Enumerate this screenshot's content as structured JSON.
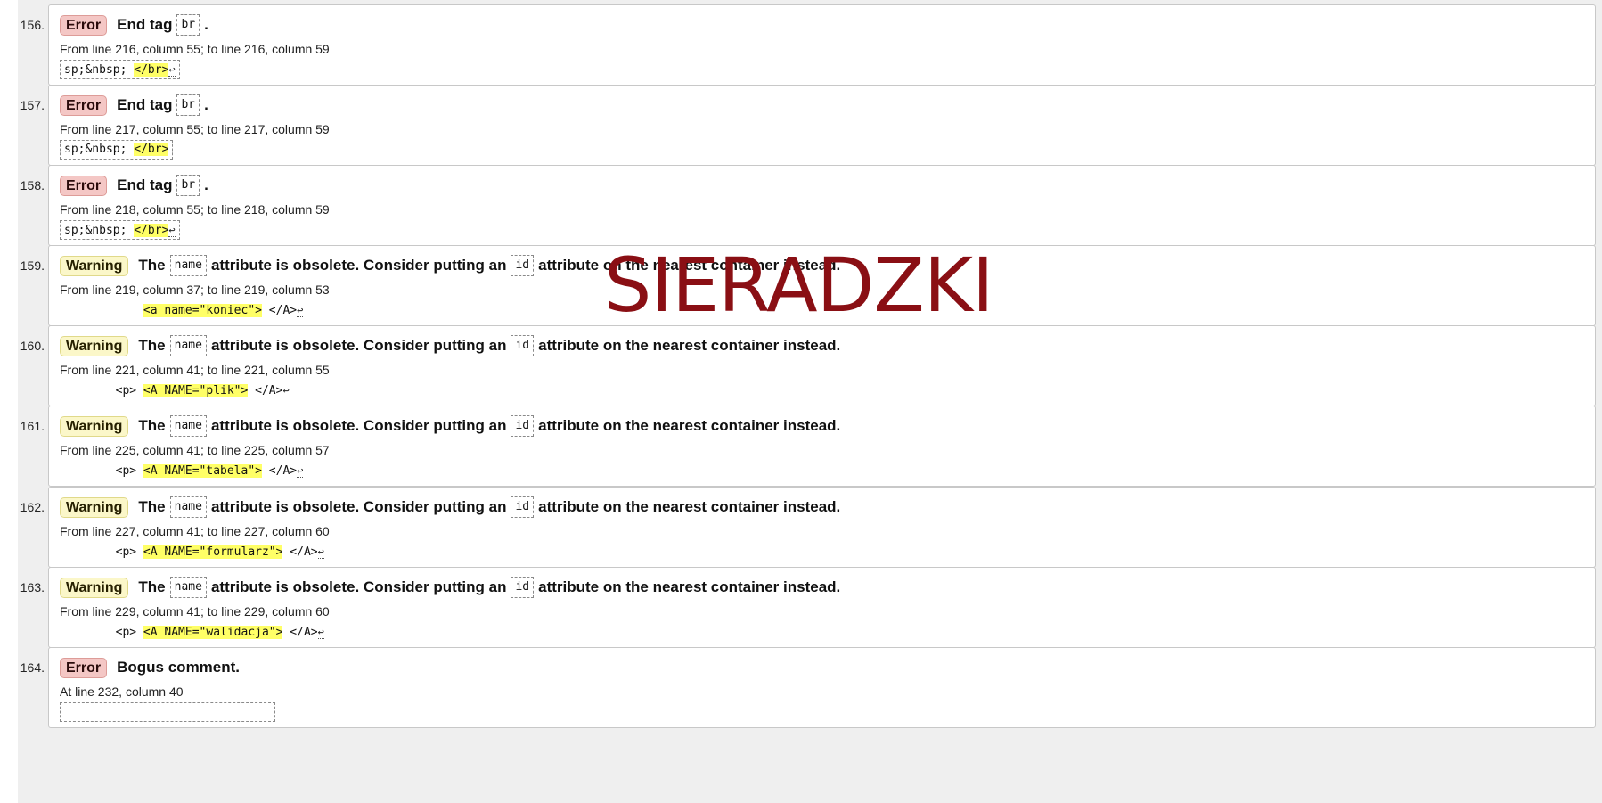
{
  "messages": [
    {
      "num": "156.",
      "type": "Error",
      "parts": [
        {
          "t": "text",
          "v": "End tag"
        },
        {
          "t": "code",
          "v": "br"
        },
        {
          "t": "text",
          "v": "."
        }
      ],
      "location": "From line 216, column 55; to line 216, column 59",
      "extract": {
        "before": "sp;&nbsp; ",
        "highlight": "</br>",
        "after": "",
        "lf": "↩",
        "style": "boxed"
      }
    },
    {
      "num": "157.",
      "type": "Error",
      "parts": [
        {
          "t": "text",
          "v": "End tag"
        },
        {
          "t": "code",
          "v": "br"
        },
        {
          "t": "text",
          "v": "."
        }
      ],
      "location": "From line 217, column 55; to line 217, column 59",
      "extract": {
        "before": "sp;&nbsp; ",
        "highlight": "</br>",
        "after": "",
        "lf": "",
        "style": "boxed"
      }
    },
    {
      "num": "158.",
      "type": "Error",
      "parts": [
        {
          "t": "text",
          "v": "End tag"
        },
        {
          "t": "code",
          "v": "br"
        },
        {
          "t": "text",
          "v": "."
        }
      ],
      "location": "From line 218, column 55; to line 218, column 59",
      "extract": {
        "before": "sp;&nbsp; ",
        "highlight": "</br>",
        "after": "",
        "lf": "↩",
        "style": "boxed"
      }
    },
    {
      "num": "159.",
      "type": "Warning",
      "parts": [
        {
          "t": "text",
          "v": "The"
        },
        {
          "t": "code",
          "v": "name"
        },
        {
          "t": "text",
          "v": "attribute is obsolete. Consider putting an"
        },
        {
          "t": "code",
          "v": "id"
        },
        {
          "t": "text",
          "v": "attribute on the nearest container instead."
        }
      ],
      "location": "From line 219, column 37; to line 219, column 53",
      "extract": {
        "before": "            ",
        "highlight": "<a name=\"koniec\">",
        "after": " </A>",
        "lf": "↩",
        "style": "plain"
      }
    },
    {
      "num": "160.",
      "type": "Warning",
      "parts": [
        {
          "t": "text",
          "v": "The"
        },
        {
          "t": "code",
          "v": "name"
        },
        {
          "t": "text",
          "v": "attribute is obsolete. Consider putting an"
        },
        {
          "t": "code",
          "v": "id"
        },
        {
          "t": "text",
          "v": "attribute on the nearest container instead."
        }
      ],
      "location": "From line 221, column 41; to line 221, column 55",
      "extract": {
        "before": "        <p> ",
        "highlight": "<A NAME=\"plik\">",
        "after": " </A>",
        "lf": "↩",
        "style": "plain"
      }
    },
    {
      "num": "161.",
      "type": "Warning",
      "parts": [
        {
          "t": "text",
          "v": "The"
        },
        {
          "t": "code",
          "v": "name"
        },
        {
          "t": "text",
          "v": "attribute is obsolete. Consider putting an"
        },
        {
          "t": "code",
          "v": "id"
        },
        {
          "t": "text",
          "v": "attribute on the nearest container instead."
        }
      ],
      "location": "From line 225, column 41; to line 225, column 57",
      "extract": {
        "before": "        <p> ",
        "highlight": "<A NAME=\"tabela\">",
        "after": " </A>",
        "lf": "↩",
        "style": "plain"
      }
    },
    {
      "num": "162.",
      "type": "Warning",
      "parts": [
        {
          "t": "text",
          "v": "The"
        },
        {
          "t": "code",
          "v": "name"
        },
        {
          "t": "text",
          "v": "attribute is obsolete. Consider putting an"
        },
        {
          "t": "code",
          "v": "id"
        },
        {
          "t": "text",
          "v": "attribute on the nearest container instead."
        }
      ],
      "location": "From line 227, column 41; to line 227, column 60",
      "extract": {
        "before": "        <p> ",
        "highlight": "<A NAME=\"formularz\">",
        "after": " </A>",
        "lf": "↩",
        "style": "plain"
      }
    },
    {
      "num": "163.",
      "type": "Warning",
      "parts": [
        {
          "t": "text",
          "v": "The"
        },
        {
          "t": "code",
          "v": "name"
        },
        {
          "t": "text",
          "v": "attribute is obsolete. Consider putting an"
        },
        {
          "t": "code",
          "v": "id"
        },
        {
          "t": "text",
          "v": "attribute on the nearest container instead."
        }
      ],
      "location": "From line 229, column 41; to line 229, column 60",
      "extract": {
        "before": "        <p> ",
        "highlight": "<A NAME=\"walidacja\">",
        "after": " </A>",
        "lf": "↩",
        "style": "plain"
      }
    },
    {
      "num": "164.",
      "type": "Error",
      "parts": [
        {
          "t": "text",
          "v": "Bogus comment."
        }
      ],
      "location": "At line 232, column 40",
      "extract": {
        "before": "",
        "highlight": "",
        "after": "",
        "lf": "",
        "style": "boxed"
      }
    }
  ],
  "watermark": "SIERADZKI",
  "colors": {
    "error_badge": "#f4c7c5",
    "warning_badge": "#fbf7c9",
    "highlight": "#ffff66",
    "watermark": "#8a0f14"
  }
}
